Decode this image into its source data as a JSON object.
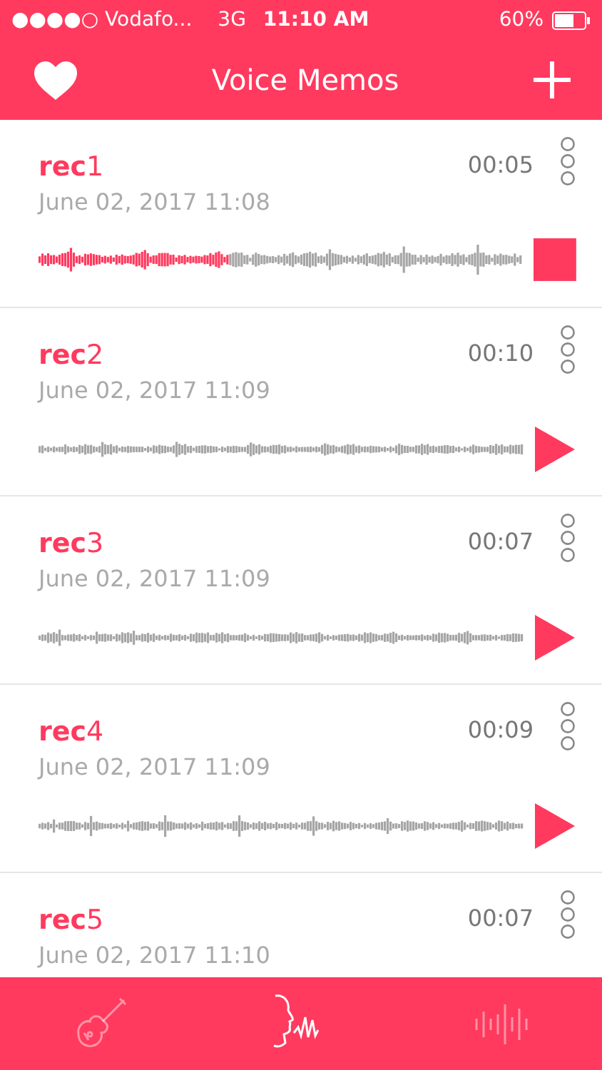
{
  "status_bar": {
    "carrier": "●●●●○ Vodafo...",
    "network": "3G",
    "time": "11:10 AM",
    "battery": "60%"
  },
  "nav": {
    "title": "Voice Memos"
  },
  "memos": [
    {
      "name": "**rec**1",
      "duration": "00:05",
      "date": "June 02, 2017 11:08",
      "playing": true,
      "level": 0.39
    },
    {
      "name": "**rec**2",
      "duration": "00:10",
      "date": "June 02, 2017 11:09",
      "playing": false
    },
    {
      "name": "**rec**3",
      "duration": "00:07",
      "date": "June 02, 2017 11:09",
      "playing": false
    },
    {
      "name": "**rec**4",
      "duration": "00:09",
      "date": "June 02, 2017 11:09",
      "playing": false
    },
    {
      "name": "**rec**5",
      "duration": "00:07",
      "date": "June 02, 2017 11:10"
    }
  ],
  "tabs": [
    {
      "kind": "guitar",
      "selected": false
    },
    {
      "kind": "voice",
      "selected": true
    },
    {
      "kind": "wave",
      "selected": false
    }
  ]
}
